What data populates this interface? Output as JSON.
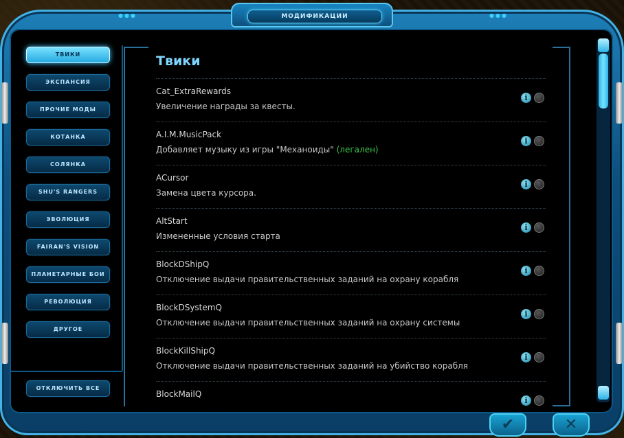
{
  "window": {
    "title": "МОДИФИКАЦИИ"
  },
  "sidebar": {
    "items": [
      {
        "label": "ТВИКИ",
        "active": true
      },
      {
        "label": "ЭКСПАНСИЯ",
        "active": false
      },
      {
        "label": "ПРОЧИЕ МОДЫ",
        "active": false
      },
      {
        "label": "КОТАНКА",
        "active": false
      },
      {
        "label": "СОЛЯНКА",
        "active": false
      },
      {
        "label": "SHU'S RANGERS",
        "active": false
      },
      {
        "label": "ЭВОЛЮЦИЯ",
        "active": false
      },
      {
        "label": "FAIRAN'S VISION",
        "active": false
      },
      {
        "label": "ПЛАНЕТАРНЫЕ БОИ",
        "active": false
      },
      {
        "label": "РЕВОЛЮЦИЯ",
        "active": false
      },
      {
        "label": "ДРУГОЕ",
        "active": false
      }
    ],
    "disable_all_label": "ОТКЛЮЧИТЬ ВСЕ"
  },
  "main": {
    "heading": "Твики",
    "mods": [
      {
        "name": "Cat_ExtraRewards",
        "description": "Увеличение награды за квесты.",
        "suffix": ""
      },
      {
        "name": "A.I.M.MusicPack",
        "description": "Добавляет музыку из игры \"Механоиды\"",
        "suffix": "(легален)"
      },
      {
        "name": "ACursor",
        "description": "Замена цвета курсора.",
        "suffix": ""
      },
      {
        "name": "AltStart",
        "description": "Измененные условия старта",
        "suffix": ""
      },
      {
        "name": "BlockDShipQ",
        "description": "Отключение выдачи правительственных заданий на охрану корабля",
        "suffix": ""
      },
      {
        "name": "BlockDSystemQ",
        "description": "Отключение выдачи правительственных заданий на охрану системы",
        "suffix": ""
      },
      {
        "name": "BlockKillShipQ",
        "description": "Отключение выдачи правительственных заданий на убийство корабля",
        "suffix": ""
      },
      {
        "name": "BlockMailQ",
        "description": "",
        "suffix": ""
      }
    ],
    "info_glyph": "i"
  },
  "footer": {
    "ok_glyph": "✔",
    "cancel_glyph": "✕"
  },
  "colors": {
    "accent": "#7fd6ff",
    "legal": "#3ec84a",
    "frame": "#0d4f7e"
  }
}
